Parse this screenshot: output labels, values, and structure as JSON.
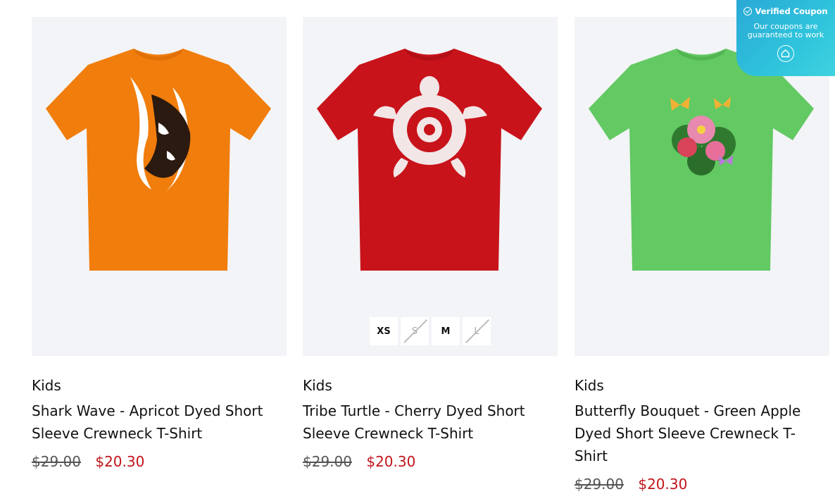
{
  "badge": {
    "title": "Verified Coupon",
    "subtitle": "Our coupons are guaranteed to work",
    "check_icon": "check-circle-icon",
    "home_icon": "home-icon"
  },
  "products": [
    {
      "category": "Kids",
      "title": "Shark Wave - Apricot Dyed Short Sleeve Crewneck T-Shirt",
      "price_old": "$29.00",
      "price_new": "$20.30",
      "shirt_color": "#f07d0c",
      "sizes": []
    },
    {
      "category": "Kids",
      "title": "Tribe Turtle - Cherry Dyed Short Sleeve Crewneck T-Shirt",
      "price_old": "$29.00",
      "price_new": "$20.30",
      "shirt_color": "#c8131b",
      "sizes": [
        {
          "label": "XS",
          "available": true
        },
        {
          "label": "S",
          "available": false
        },
        {
          "label": "M",
          "available": true
        },
        {
          "label": "L",
          "available": false
        }
      ]
    },
    {
      "category": "Kids",
      "title": "Butterfly Bouquet - Green Apple Dyed Short Sleeve Crewneck T-Shirt",
      "price_old": "$29.00",
      "price_new": "$20.30",
      "shirt_color": "#63c963",
      "sizes": []
    }
  ],
  "colors": {
    "sale_price": "#c0141a",
    "card_bg": "#f3f4f7",
    "badge_bg": "#2fc4dc"
  }
}
